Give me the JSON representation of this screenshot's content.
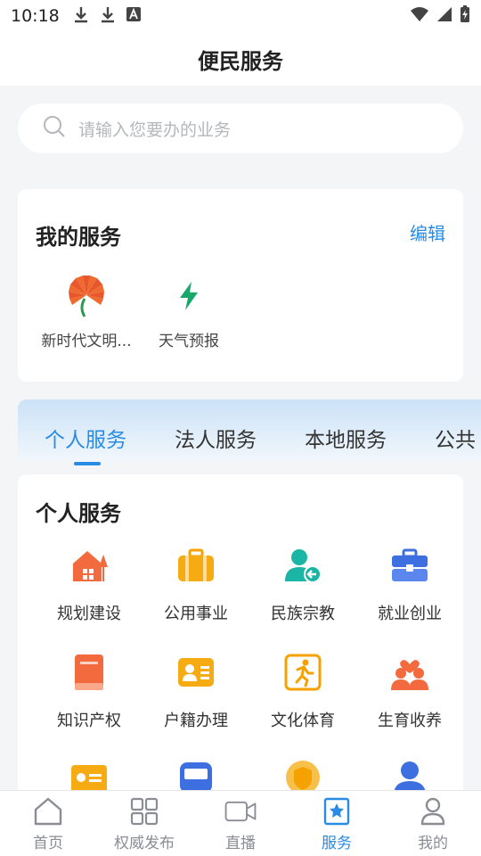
{
  "status_bar": {
    "time": "10:18"
  },
  "header": {
    "title": "便民服务"
  },
  "search": {
    "placeholder": "请输入您要办的业务"
  },
  "my_services": {
    "title": "我的服务",
    "edit_label": "编辑",
    "items": [
      {
        "label": "新时代文明...",
        "icon": "civilization-emblem-icon"
      },
      {
        "label": "天气预报",
        "icon": "lightning-icon"
      }
    ]
  },
  "tabs": [
    {
      "label": "个人服务",
      "active": true
    },
    {
      "label": "法人服务",
      "active": false
    },
    {
      "label": "本地服务",
      "active": false
    },
    {
      "label": "公共",
      "active": false
    }
  ],
  "personal_services": {
    "title": "个人服务",
    "items": [
      {
        "label": "规划建设",
        "icon": "house-icon"
      },
      {
        "label": "公用事业",
        "icon": "briefcase-icon"
      },
      {
        "label": "民族宗教",
        "icon": "user-return-icon"
      },
      {
        "label": "就业创业",
        "icon": "toolbox-icon"
      },
      {
        "label": "知识产权",
        "icon": "book-icon"
      },
      {
        "label": "户籍办理",
        "icon": "id-card-icon"
      },
      {
        "label": "文化体育",
        "icon": "runner-icon"
      },
      {
        "label": "生育收养",
        "icon": "family-heart-icon"
      }
    ]
  },
  "bottom_nav": [
    {
      "label": "首页",
      "icon": "home-icon",
      "active": false
    },
    {
      "label": "权威发布",
      "icon": "grid-icon",
      "active": false
    },
    {
      "label": "直播",
      "icon": "video-camera-icon",
      "active": false
    },
    {
      "label": "服务",
      "icon": "star-bookmark-icon",
      "active": true
    },
    {
      "label": "我的",
      "icon": "person-icon",
      "active": false
    }
  ],
  "colors": {
    "accent": "#2a8be5",
    "inactive": "#8a8d94",
    "background": "#f4f5f7"
  }
}
